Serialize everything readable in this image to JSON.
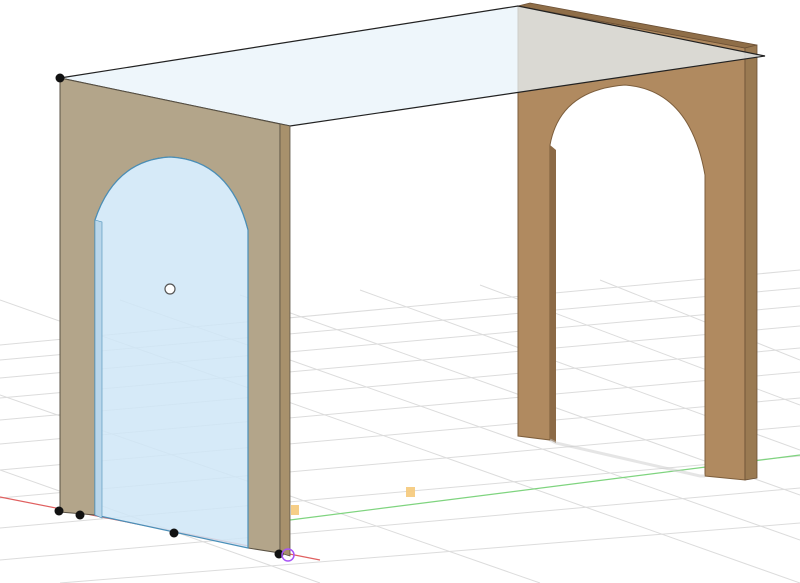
{
  "viewport": {
    "background": "#ffffff",
    "grid_color": "#dcdcdc",
    "x_axis_color": "#e06060",
    "y_axis_color": "#7fd47f"
  },
  "scene": {
    "wood_left_face": "#b3a58a",
    "wood_right_face": "#b08a60",
    "wood_edge": "#9a7a52",
    "selection_fill": "#cfe6f7",
    "selection_stroke": "#4a8fb8",
    "tabletop_fill": "#e8f3fa",
    "tabletop_stroke": "#222222"
  },
  "markers": {
    "origin_marker_color": "#a855f7",
    "handle_color": "#f5c97a"
  }
}
